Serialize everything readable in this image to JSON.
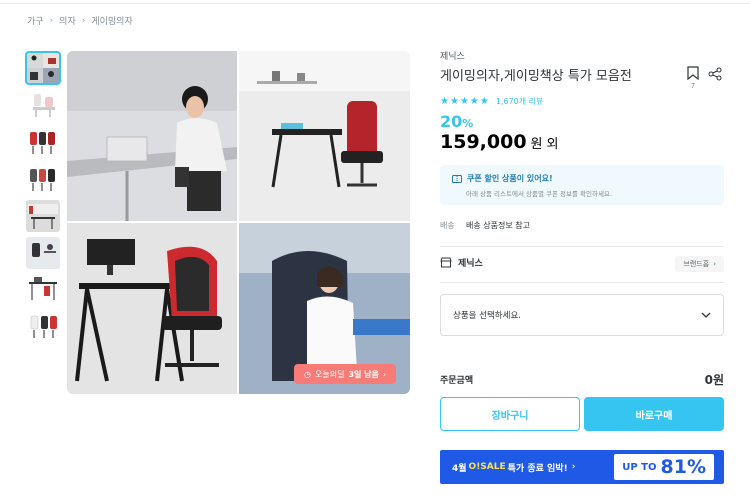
{
  "breadcrumb": [
    "가구",
    "의자",
    "게이밍의자"
  ],
  "product": {
    "brand": "제닉스",
    "title": "게이밍의자,게이밍책상 특가 모음전",
    "bookmark_count": "7",
    "review_count": "1,670개 리뷰",
    "rating": 5,
    "discount": "20",
    "discount_unit": "%",
    "price": "159,000",
    "price_unit": "원",
    "price_suffix": "외"
  },
  "timer": {
    "label": "오늘의딜",
    "remaining": "3일 남음"
  },
  "coupon": {
    "title": "쿠폰 할인 상품이 있어요!",
    "desc": "아래 상품 리스트에서 상품별 쿠폰 정보를 확인하세요."
  },
  "shipping": {
    "label": "배송",
    "value": "배송 상품정보 참고"
  },
  "seller": {
    "name": "제닉스",
    "home_label": "브랜드홈"
  },
  "option_select": {
    "placeholder": "상품을 선택하세요."
  },
  "order": {
    "label": "주문금액",
    "value": "0원"
  },
  "buttons": {
    "cart": "장바구니",
    "buy": "바로구매"
  },
  "banner": {
    "prefix": "4월",
    "highlight": "O!SALE",
    "suffix": "특가 종료 임박!",
    "upto": "UP TO",
    "percent": "81%"
  },
  "colors": {
    "accent": "#35c5f0",
    "banner": "#1e5ae6",
    "timer": "#f77c77"
  }
}
